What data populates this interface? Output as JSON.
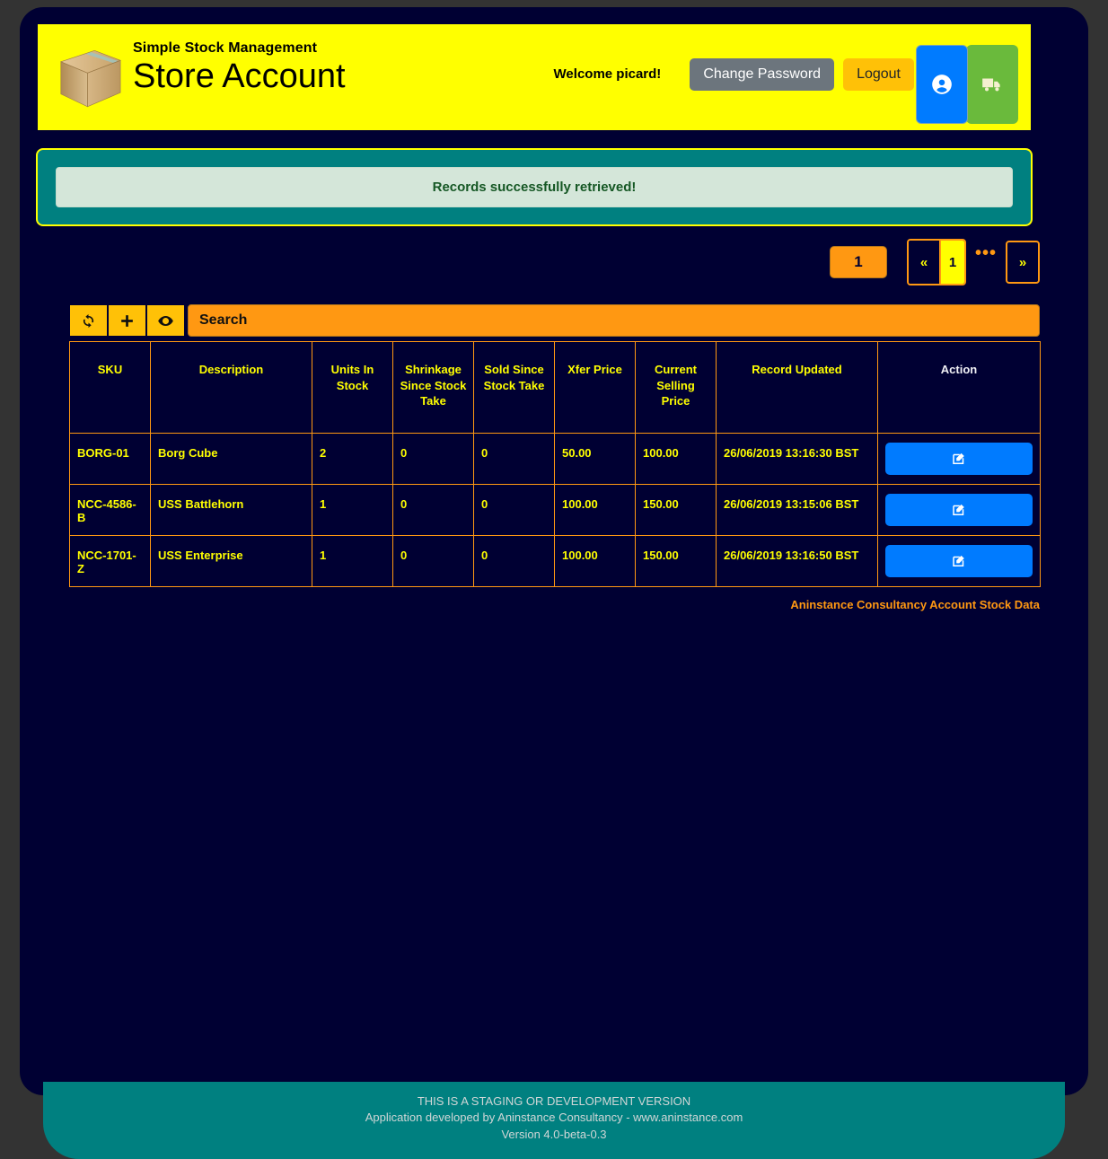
{
  "header": {
    "app_subtitle": "Simple Stock Management",
    "page_title": "Store Account",
    "logo_icon": "cardboard-box-icon",
    "welcome": "Welcome picard!",
    "change_password_label": "Change Password",
    "logout_label": "Logout",
    "account_icon": "user-circle-icon",
    "delivery_icon": "delivery-truck-icon",
    "colors": {
      "banner_bg": "#ffff00",
      "change_password_bg": "#6c757d",
      "logout_bg": "#ffc107",
      "account_bg": "#007bff",
      "delivery_bg": "#6aba3c"
    }
  },
  "alert": {
    "message": "Records successfully retrieved!",
    "outer_bg": "#008080",
    "inner_bg": "#d4e6d9",
    "text_color": "#155724"
  },
  "pagination": {
    "page_count": "1",
    "first_label": "«",
    "current_page": "1",
    "ellipsis": "•••",
    "last_label": "»"
  },
  "toolbar": {
    "refresh_icon": "refresh-icon",
    "add_icon": "plus-icon",
    "view_icon": "eye-icon",
    "search_placeholder": "Search",
    "search_value": ""
  },
  "table": {
    "columns": [
      "SKU",
      "Description",
      "Units In Stock",
      "Shrinkage Since Stock Take",
      "Sold Since Stock Take",
      "Xfer Price",
      "Current Selling Price",
      "Record Updated",
      "Action"
    ],
    "rows": [
      {
        "sku": "BORG-01",
        "description": "Borg Cube",
        "units_in_stock": "2",
        "shrinkage": "0",
        "sold": "0",
        "xfer_price": "50.00",
        "selling_price": "100.00",
        "record_updated": "26/06/2019 13:16:30 BST",
        "action_icon": "edit-icon"
      },
      {
        "sku": "NCC-4586-B",
        "description": "USS Battlehorn",
        "units_in_stock": "1",
        "shrinkage": "0",
        "sold": "0",
        "xfer_price": "100.00",
        "selling_price": "150.00",
        "record_updated": "26/06/2019 13:15:06 BST",
        "action_icon": "edit-icon"
      },
      {
        "sku": "NCC-1701-Z",
        "description": "USS Enterprise",
        "units_in_stock": "1",
        "shrinkage": "0",
        "sold": "0",
        "xfer_price": "100.00",
        "selling_price": "150.00",
        "record_updated": "26/06/2019 13:16:50 BST",
        "action_icon": "edit-icon"
      }
    ],
    "caption": "Aninstance Consultancy Account Stock Data"
  },
  "footer": {
    "line1": "THIS IS A STAGING OR DEVELOPMENT VERSION",
    "line2": "Application developed by Aninstance Consultancy - www.aninstance.com",
    "line3": "Version 4.0-beta-0.3"
  }
}
